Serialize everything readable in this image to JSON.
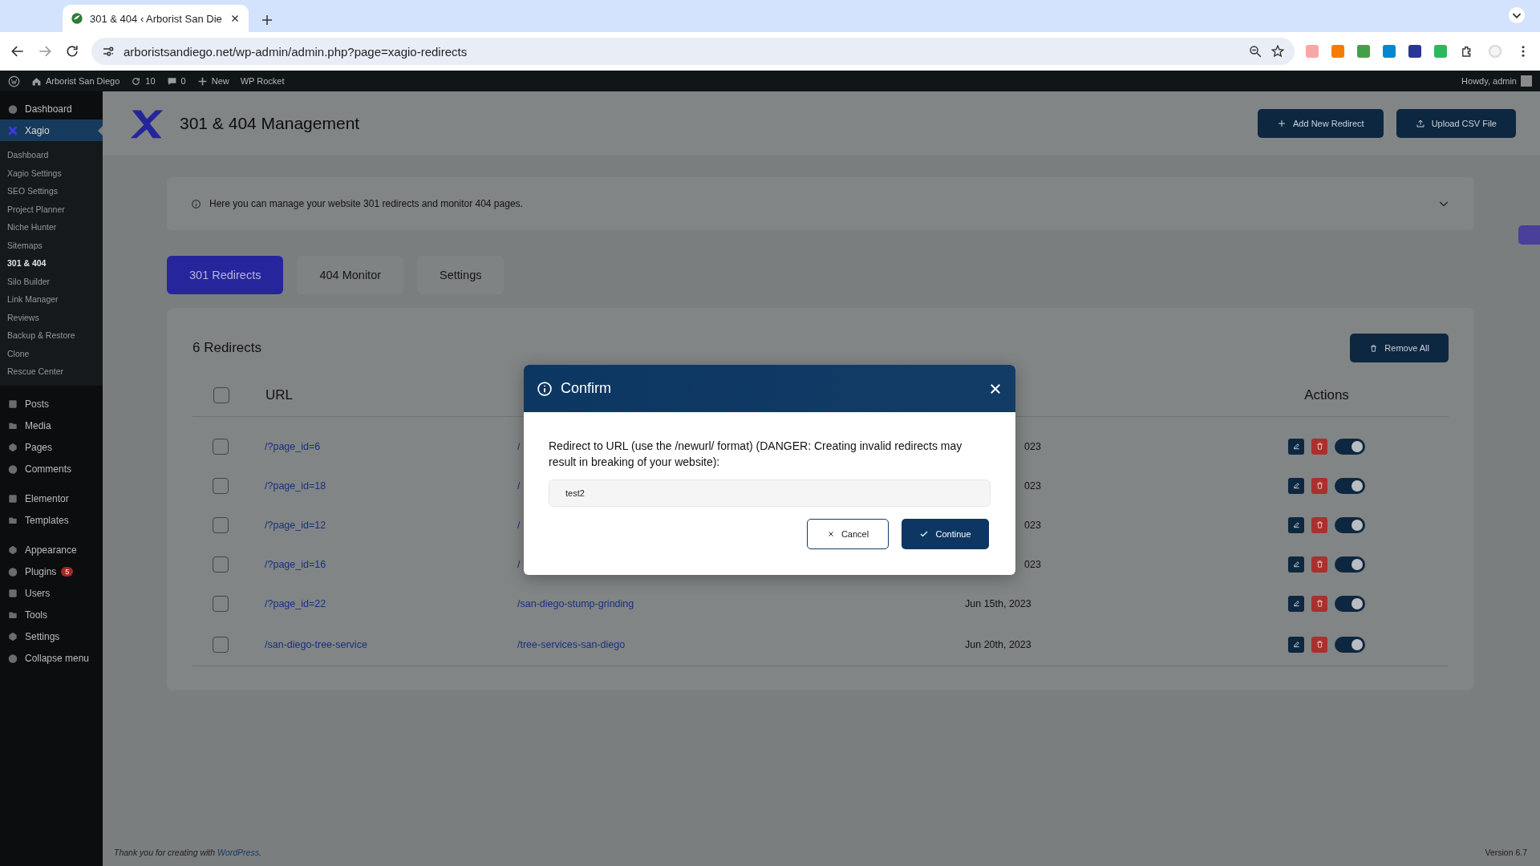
{
  "browser": {
    "tab_title": "301 & 404 ‹ Arborist San Die",
    "url": "arboristsandiego.net/wp-admin/admin.php?page=xagio-redirects"
  },
  "admin_bar": {
    "site": "Arborist San Diego",
    "updates": "10",
    "comments": "0",
    "new": "New",
    "plugin": "WP Rocket",
    "howdy": "Howdy, admin"
  },
  "sidebar": {
    "groups": [
      [
        {
          "label": "Dashboard",
          "selected": false
        },
        {
          "label": "Xagio",
          "selected": true,
          "children": [
            {
              "label": "Dashboard",
              "selected": false
            },
            {
              "label": "Xagio Settings",
              "selected": false
            },
            {
              "label": "SEO Settings",
              "selected": false
            },
            {
              "label": "Project Planner",
              "selected": false
            },
            {
              "label": "Niche Hunter",
              "selected": false
            },
            {
              "label": "Sitemaps",
              "selected": false
            },
            {
              "label": "301 & 404",
              "selected": true
            },
            {
              "label": "Silo Builder",
              "selected": false
            },
            {
              "label": "Link Manager",
              "selected": false
            },
            {
              "label": "Reviews",
              "selected": false
            },
            {
              "label": "Backup & Restore",
              "selected": false
            },
            {
              "label": "Clone",
              "selected": false
            },
            {
              "label": "Rescue Center",
              "selected": false
            }
          ]
        }
      ],
      [
        {
          "label": "Posts",
          "selected": false
        },
        {
          "label": "Media",
          "selected": false
        },
        {
          "label": "Pages",
          "selected": false
        },
        {
          "label": "Comments",
          "selected": false
        }
      ],
      [
        {
          "label": "Elementor",
          "selected": false
        },
        {
          "label": "Templates",
          "selected": false
        }
      ],
      [
        {
          "label": "Appearance",
          "selected": false
        },
        {
          "label": "Plugins",
          "selected": false,
          "badge": "5"
        },
        {
          "label": "Users",
          "selected": false
        },
        {
          "label": "Tools",
          "selected": false
        },
        {
          "label": "Settings",
          "selected": false
        },
        {
          "label": "Collapse menu",
          "selected": false
        }
      ]
    ]
  },
  "header": {
    "title": "301 & 404 Management",
    "buttons": [
      "Add New Redirect",
      "Upload CSV File"
    ]
  },
  "notice": {
    "text": "Here you can manage your website 301 redirects and monitor 404 pages."
  },
  "tabs": [
    {
      "label": "301 Redirects",
      "selected": true
    },
    {
      "label": "404 Monitor",
      "selected": false
    },
    {
      "label": "Settings",
      "selected": false
    }
  ],
  "panel": {
    "title": "6 Redirects",
    "remove_all": "Remove All",
    "select_all_checked": false,
    "columns": [
      "URL",
      "Actions"
    ],
    "rows": [
      {
        "checked": false,
        "url": "/?page_id=6",
        "column_2": "/",
        "column_3": "023",
        "enabled": true
      },
      {
        "checked": false,
        "url": "/?page_id=18",
        "column_2": "/",
        "column_3": "023",
        "enabled": true
      },
      {
        "checked": false,
        "url": "/?page_id=12",
        "column_2": "/",
        "column_3": "023",
        "enabled": true
      },
      {
        "checked": false,
        "url": "/?page_id=16",
        "column_2": "/",
        "column_3": "023",
        "enabled": true
      },
      {
        "checked": false,
        "url": "/?page_id=22",
        "column_2": "/san-diego-stump-grinding",
        "column_3": "Jun 15th, 2023",
        "enabled": true
      },
      {
        "checked": false,
        "url": "/san-diego-tree-service",
        "column_2": "/tree-services-san-diego",
        "column_3": "Jun 20th, 2023",
        "enabled": true
      }
    ]
  },
  "dialog": {
    "title": "Confirm",
    "message": "Redirect to URL (use the /newurl/ format) (DANGER: Creating invalid redirects may result in breaking of your website):",
    "value": "test2",
    "cancel": "Cancel",
    "continue": "Continue"
  },
  "footer": {
    "credit_prefix": "Thank you for creating with",
    "credit_link": "WordPress",
    "credit_suffix": ".",
    "version": "Version 6.7"
  }
}
